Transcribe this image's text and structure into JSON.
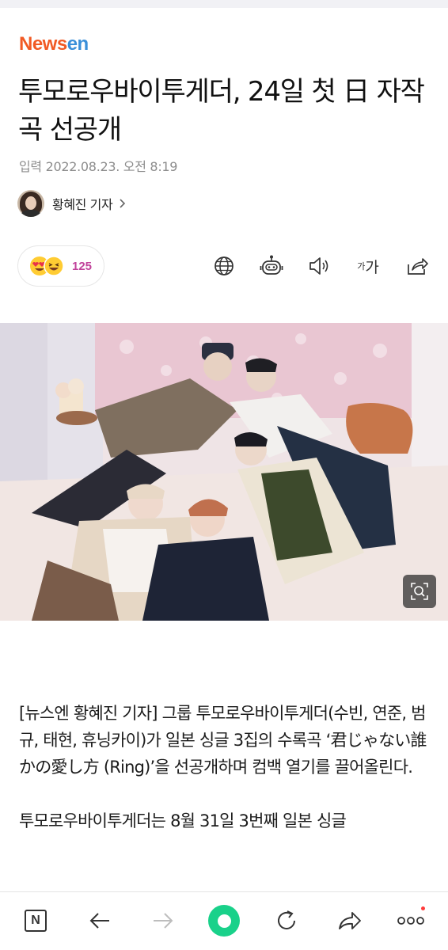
{
  "brand": {
    "logo_part1": "News",
    "logo_part2": "en",
    "accent": "#f15a24",
    "accent2": "#3a8fd9"
  },
  "article": {
    "headline": "투모로우바이투게더, 24일 첫 日 자작곡 선공개",
    "date": "입력 2022.08.23. 오전 8:19",
    "reporter": "황혜진 기자"
  },
  "reactions": {
    "count": "125",
    "emojis": [
      "heart-eyes-emoji",
      "laughing-emoji"
    ]
  },
  "tools": [
    "globe-icon",
    "robot-icon",
    "speaker-icon",
    "font-size-icon",
    "share-icon"
  ],
  "font_size_label": {
    "small": "가",
    "large": "가"
  },
  "body": {
    "paragraph1": "[뉴스엔 황혜진 기자] 그룹 투모로우바이투게더(수빈, 연준, 범규, 태현, 휴닝카이)가 일본 싱글 3집의 수록곡 ‘君じゃない誰かの愛し方 (Ring)’을 선공개하며 컴백 열기를 끌어올린다.",
    "paragraph2": "투모로우바이투게더는 8월 31일 3번째 일본 싱글"
  },
  "bottom_nav": {
    "n_label": "N",
    "items": [
      "naver-n-icon",
      "back-arrow-icon",
      "forward-arrow-icon",
      "home-green-icon",
      "refresh-icon",
      "share-icon",
      "more-icon"
    ],
    "notification_color": "#ff3b3b"
  }
}
